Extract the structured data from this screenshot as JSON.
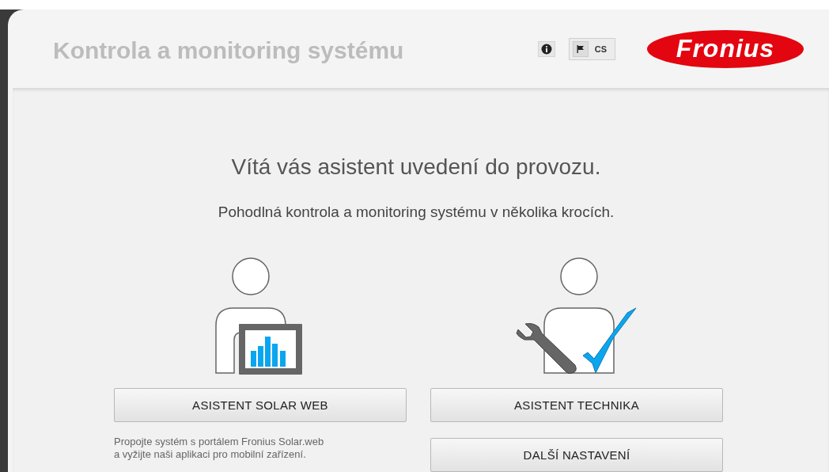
{
  "header": {
    "title": "Kontrola a monitoring systému",
    "language": "CS",
    "logo": "Fronius"
  },
  "welcome": {
    "heading": "Vítá vás asistent uvedení do provozu.",
    "subtitle": "Pohodlná kontrola a monitoring systému v několika krocích."
  },
  "options": [
    {
      "kind": "solarweb",
      "button": "ASISTENT SOLAR WEB",
      "description": [
        "Propojte systém s portálem Fronius Solar.web",
        "a vyžijte naši aplikaci pro mobilní zařízení."
      ]
    },
    {
      "kind": "technician",
      "button": "ASISTENT TECHNIKA",
      "extra_button": "DALŠÍ NASTAVENÍ"
    }
  ]
}
